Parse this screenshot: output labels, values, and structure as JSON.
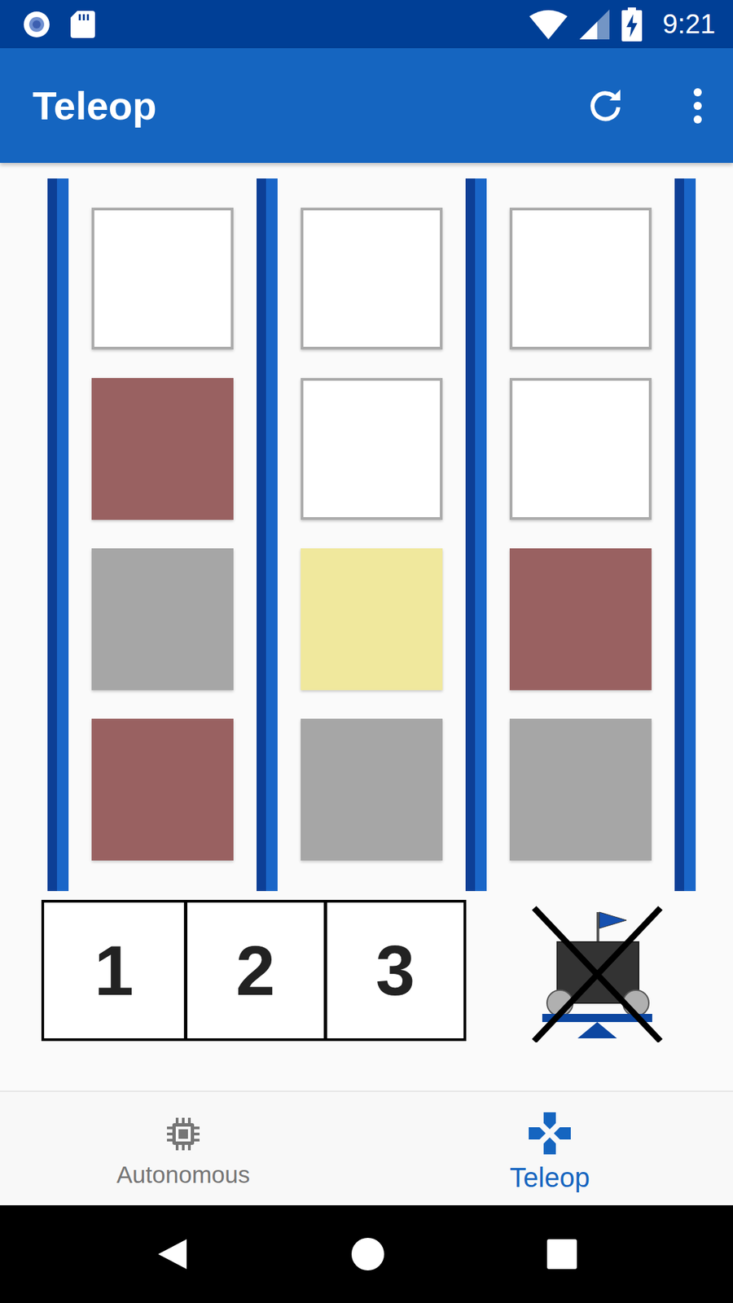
{
  "status_bar": {
    "time": "9:21"
  },
  "app_bar": {
    "title": "Teleop"
  },
  "cryptobox": {
    "columns": [
      {
        "cells": [
          {
            "filled": false,
            "color": "#ffffff"
          },
          {
            "filled": true,
            "color": "#996161"
          },
          {
            "filled": true,
            "color": "#a6a6a6"
          },
          {
            "filled": true,
            "color": "#996161"
          }
        ]
      },
      {
        "cells": [
          {
            "filled": false,
            "color": "#ffffff"
          },
          {
            "filled": false,
            "color": "#ffffff"
          },
          {
            "filled": true,
            "color": "#f0e89d"
          },
          {
            "filled": true,
            "color": "#a6a6a6"
          }
        ]
      },
      {
        "cells": [
          {
            "filled": false,
            "color": "#ffffff"
          },
          {
            "filled": false,
            "color": "#ffffff"
          },
          {
            "filled": true,
            "color": "#996161"
          },
          {
            "filled": true,
            "color": "#a6a6a6"
          }
        ]
      }
    ]
  },
  "cipher_buttons": [
    {
      "label": "1",
      "selected": false
    },
    {
      "label": "2",
      "selected": false
    },
    {
      "label": "3",
      "selected": false
    }
  ],
  "balance_toggle": {
    "on": false
  },
  "bottom_nav": [
    {
      "label": "Autonomous",
      "selected": false
    },
    {
      "label": "Teleop",
      "selected": true
    }
  ]
}
